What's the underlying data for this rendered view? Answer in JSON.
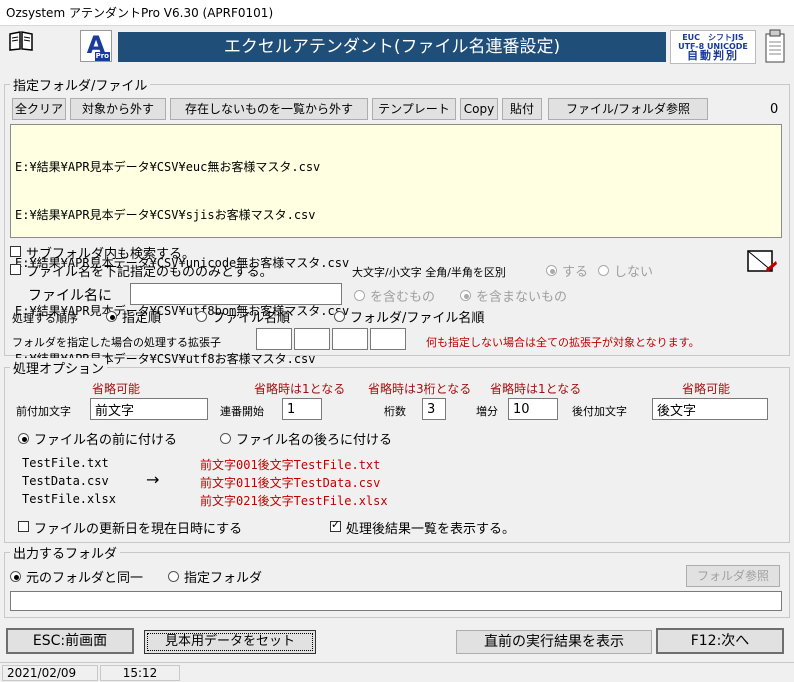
{
  "window": {
    "title": "Ozsystem アテンダントPro V6.30 (APRF0101)"
  },
  "header": {
    "banner": "エクセルアテンダント(ファイル名連番設定)",
    "logo_letter": "A",
    "logo_sub": "Pro",
    "encoding_line1": "EUC　シフトJIS",
    "encoding_line2": "UTF-8 UNICODE",
    "encoding_line3": "自動判別"
  },
  "folder_group": {
    "legend": "指定フォルダ/ファイル",
    "buttons": {
      "clear_all": "全クリア",
      "remove": "対象から外す",
      "remove_missing": "存在しないものを一覧から外す",
      "template": "テンプレート",
      "copy": "Copy",
      "paste": "貼付",
      "browse": "ファイル/フォルダ参照"
    },
    "count": "0",
    "files": [
      "E:¥結果¥APR見本データ¥CSV¥euc無お客様マスタ.csv",
      "E:¥結果¥APR見本データ¥CSV¥sjisお客様マスタ.csv",
      "E:¥結果¥APR見本データ¥CSV¥unicode無お客様マスタ.csv",
      "E:¥結果¥APR見本データ¥CSV¥utf8bom無お客様マスタ.csv",
      "E:¥結果¥APR見本データ¥CSV¥utf8お客様マスタ.csv"
    ],
    "subfolder_label": "サブフォルダ内も検索する。",
    "filename_only_label": "ファイル名を下記指定のもののみとする。",
    "case_label": "大文字/小文字 全角/半角を区別",
    "case_yes": "する",
    "case_no": "しない",
    "filename_label": "ファイル名に",
    "contains": "を含むもの",
    "not_contains": "を含まないもの",
    "order_label": "処理する順序",
    "order_specified": "指定順",
    "order_filename": "ファイル名順",
    "order_folder_file": "フォルダ/ファイル名順",
    "ext_label": "フォルダを指定した場合の処理する拡張子",
    "ext_note": "何も指定しない場合は全ての拡張子が対象となります。"
  },
  "options_group": {
    "legend": "処理オプション",
    "optional1": "省略可能",
    "default_one1": "省略時は1となる",
    "default_three": "省略時は3桁となる",
    "default_one2": "省略時は1となる",
    "optional2": "省略可能",
    "prefix_label": "前付加文字",
    "prefix_value": "前文字",
    "start_label": "連番開始",
    "start_value": "1",
    "digits_label": "桁数",
    "digits_value": "3",
    "increment_label": "増分",
    "increment_value": "10",
    "suffix_label": "後付加文字",
    "suffix_value": "後文字",
    "before_name": "ファイル名の前に付ける",
    "after_name": "ファイル名の後ろに付ける",
    "examples_src": [
      "TestFile.txt",
      "TestData.csv",
      "TestFile.xlsx"
    ],
    "arrow": "→",
    "examples_dst": [
      "前文字001後文字TestFile.txt",
      "前文字011後文字TestData.csv",
      "前文字021後文字TestFile.xlsx"
    ],
    "update_date_label": "ファイルの更新日を現在日時にする",
    "show_result_label": "処理後結果一覧を表示する。"
  },
  "output_group": {
    "legend": "出力するフォルダ",
    "same_folder": "元のフォルダと同一",
    "specified_folder": "指定フォルダ",
    "browse": "フォルダ参照"
  },
  "footer": {
    "esc": "ESC:前画面",
    "sample": "見本用データをセット",
    "last_result": "直前の実行結果を表示",
    "next": "F12:次へ"
  },
  "status": {
    "date": "2021/02/09",
    "time": "15:12"
  }
}
